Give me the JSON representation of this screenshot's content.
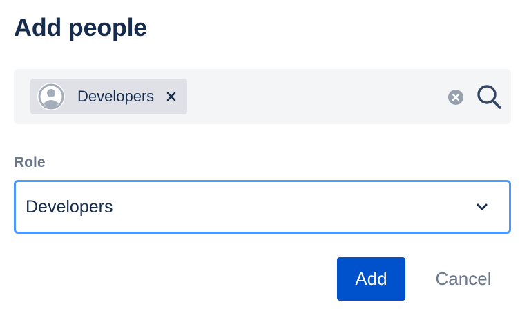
{
  "dialog": {
    "title": "Add people"
  },
  "people_picker": {
    "selected": [
      {
        "label": "Developers",
        "icon": "avatar-icon"
      }
    ],
    "clear_icon": "clear-icon",
    "search_icon": "search-icon"
  },
  "role": {
    "label": "Role",
    "value": "Developers",
    "icon": "chevron-down-icon"
  },
  "actions": {
    "add_label": "Add",
    "cancel_label": "Cancel"
  },
  "colors": {
    "title": "#172b4d",
    "primary": "#0052cc",
    "focus_border": "#4c9aff",
    "picker_bg": "#f4f5f7",
    "chip_bg": "#dfe1e6",
    "muted_text": "#6b778c"
  }
}
